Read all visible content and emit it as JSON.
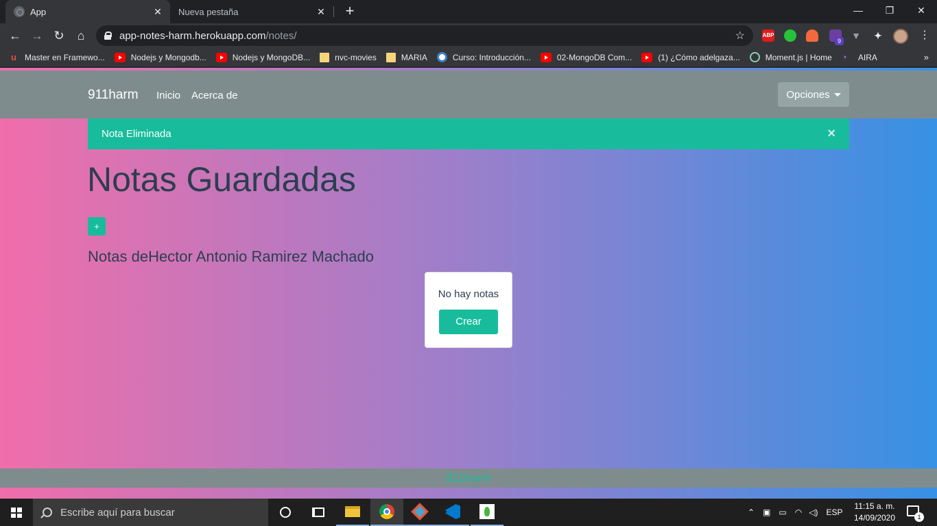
{
  "browser": {
    "tabs": [
      {
        "title": "App",
        "active": true
      },
      {
        "title": "Nueva pestaña",
        "active": false
      }
    ],
    "url_host": "app-notes-harm.herokuapp.com",
    "url_path": "/notes/",
    "extensions": [
      {
        "name": "adblock-plus-icon",
        "label": "ABP",
        "color": "#e21b1b"
      },
      {
        "name": "thumbs-up-extension-icon",
        "label": "",
        "color": "#26c33a"
      },
      {
        "name": "lighthouse-extension-icon",
        "label": "",
        "color": "#f4693c"
      },
      {
        "name": "gem-extension-icon",
        "label": "9",
        "color": "#6b3fa0"
      },
      {
        "name": "vue-devtools-icon",
        "label": "",
        "color": "#9aa0a6"
      }
    ]
  },
  "bookmarks": [
    {
      "label": "Master en Framewo...",
      "icon": "udemy-icon"
    },
    {
      "label": "Nodejs y Mongodb...",
      "icon": "youtube-icon"
    },
    {
      "label": "Nodejs y MongoDB...",
      "icon": "youtube-icon"
    },
    {
      "label": "nvc-movies",
      "icon": "folder-icon"
    },
    {
      "label": "MARIA",
      "icon": "folder-icon"
    },
    {
      "label": "Curso: Introducción...",
      "icon": "course-icon"
    },
    {
      "label": "02-MongoDB Com...",
      "icon": "youtube-icon"
    },
    {
      "label": "(1) ¿Cómo adelgaza...",
      "icon": "youtube-icon"
    },
    {
      "label": "Moment.js | Home",
      "icon": "clock-icon"
    },
    {
      "label": "AIRA",
      "icon": "aira-icon"
    }
  ],
  "bookmarks_more": "»",
  "app": {
    "brand": "911harm",
    "nav": {
      "home": "Inicio",
      "about": "Acerca de"
    },
    "options_label": "Opciones",
    "alert": {
      "message": "Nota Eliminada",
      "close": "×"
    },
    "title": "Notas Guardadas",
    "add_label": "+",
    "owner_prefix": "Notas de",
    "owner_name": "Hector Antonio Ramirez Machado",
    "empty": {
      "message": "No hay notas",
      "button": "Crear"
    },
    "footer": "911harm"
  },
  "taskbar": {
    "search_placeholder": "Escribe aquí para buscar",
    "language": "ESP",
    "time": "11:15 a. m.",
    "date": "14/09/2020",
    "notification_count": "1"
  },
  "colors": {
    "accent": "#18bc9c",
    "navbar": "#7f8c8d",
    "gradient_start": "#f06eaa",
    "gradient_end": "#3791e4"
  }
}
